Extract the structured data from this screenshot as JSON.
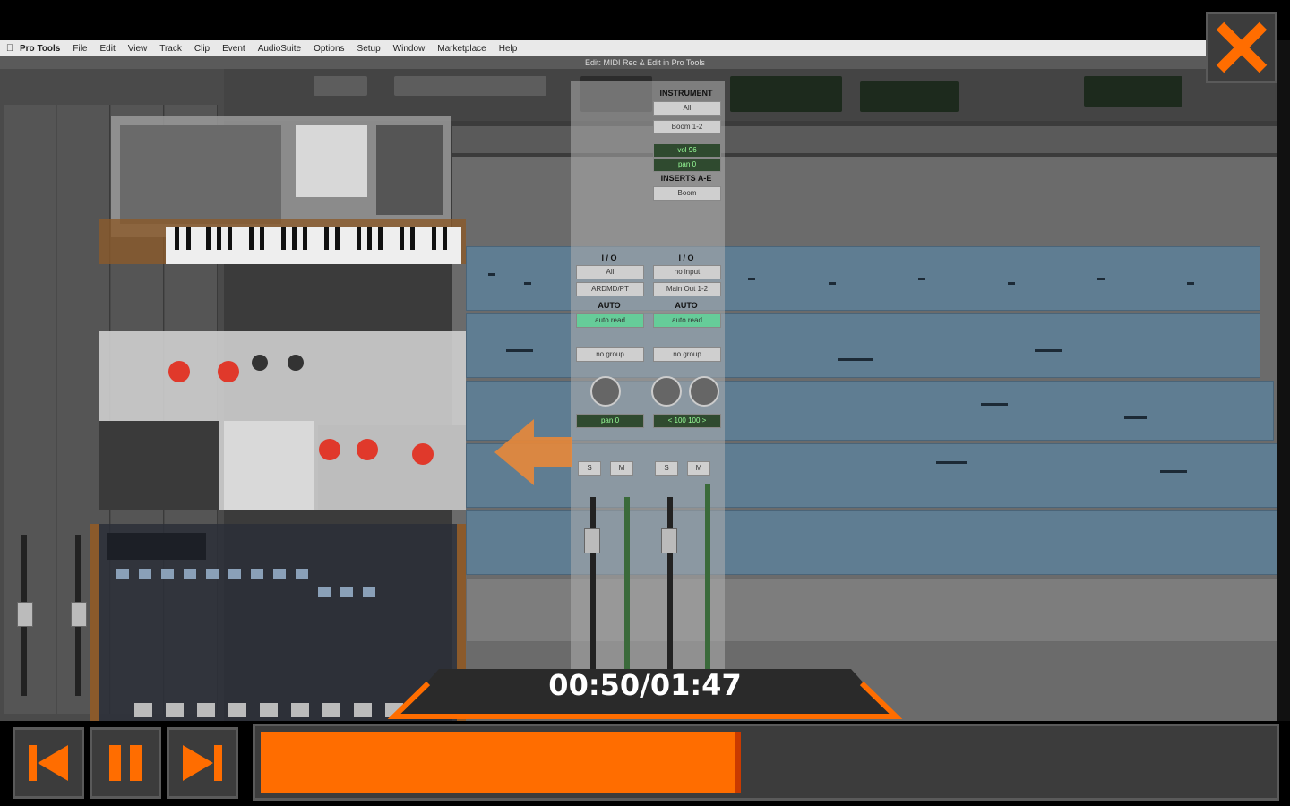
{
  "menubar": {
    "apple": "",
    "items": [
      "Pro Tools",
      "File",
      "Edit",
      "View",
      "Track",
      "Clip",
      "Event",
      "AudioSuite",
      "Options",
      "Setup",
      "Window",
      "Marketplace",
      "Help"
    ]
  },
  "window": {
    "title": "Edit: MIDI Rec & Edit in Pro Tools"
  },
  "mixer": {
    "instrument_label": "INSTRUMENT",
    "all_label": "All",
    "boom_label": "Boom 1-2",
    "vol_label": "vol",
    "vol_value": "96",
    "pan_label": "pan",
    "pan_value": "0",
    "inserts_label": "INSERTS A-E",
    "insert_slot": "Boom",
    "io_label": "I / O",
    "io_a_input": "All",
    "io_b_input": "no input",
    "io_a_output": "ARDMD/PT",
    "io_b_output": "Main Out 1-2",
    "auto_label": "AUTO",
    "auto_mode": "auto read",
    "group_label": "no group",
    "pan_a": "pan",
    "pan_a_value": "0",
    "pan_b_left": "< 100",
    "pan_b_right": "100 >",
    "solo": "S",
    "mute": "M"
  },
  "player": {
    "timecode": "00:50/01:47",
    "current": "00:50",
    "duration": "01:47",
    "progress": 0.475,
    "prev_icon": "skip-back-icon",
    "pause_icon": "pause-icon",
    "next_icon": "skip-forward-icon",
    "close_icon": "close-icon",
    "accent": "#ff6d00",
    "panel_bg": "#3c3c3c"
  }
}
